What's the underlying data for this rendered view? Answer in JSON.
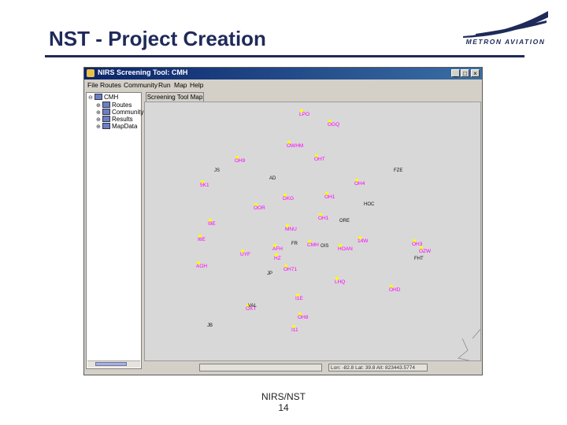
{
  "slide": {
    "title": "NST - Project Creation",
    "logo_text": "METRON AVIATION",
    "footer_line1": "NIRS/NST",
    "footer_line2": "14",
    "colors": {
      "title": "#1f2a5a",
      "marker_label": "#ff00ff",
      "marker_dot": "#ffff00"
    }
  },
  "window": {
    "title": "NIRS Screening Tool: CMH",
    "buttons": {
      "minimize": "_",
      "maximize": "□",
      "close": "×"
    },
    "menu": [
      "File",
      "Routes",
      "Community",
      "Run",
      "Map",
      "Help"
    ]
  },
  "tree": {
    "root": "CMH",
    "children": [
      "Routes",
      "Community",
      "Results",
      "MapData"
    ]
  },
  "tab": {
    "label": "Screening Tool Map"
  },
  "status": {
    "left": "",
    "right": "Lon: -82.8 Lat: 39.8 Alt: 823443.5774"
  },
  "map_labels": {
    "magenta": [
      "LPO",
      "OGQ",
      "OWHM",
      "OHT",
      "OH9",
      "OH4",
      "5K1",
      "OH1",
      "DKG",
      "OOR",
      "OH1",
      "I9E",
      "I6E",
      "14W",
      "MNU",
      "CMH",
      "HOAN",
      "OH3",
      "UYF",
      "AFH",
      "HZ",
      "OH71",
      "AOH",
      "LHQ",
      "I1E",
      "OHD",
      "OXT",
      "OH8",
      "I11",
      "OZW"
    ],
    "black": [
      "JS",
      "AD",
      "FZE",
      "ORE",
      "FHT",
      "OIS",
      "JP",
      "HOC",
      "FR",
      "VAL",
      "JB"
    ]
  }
}
